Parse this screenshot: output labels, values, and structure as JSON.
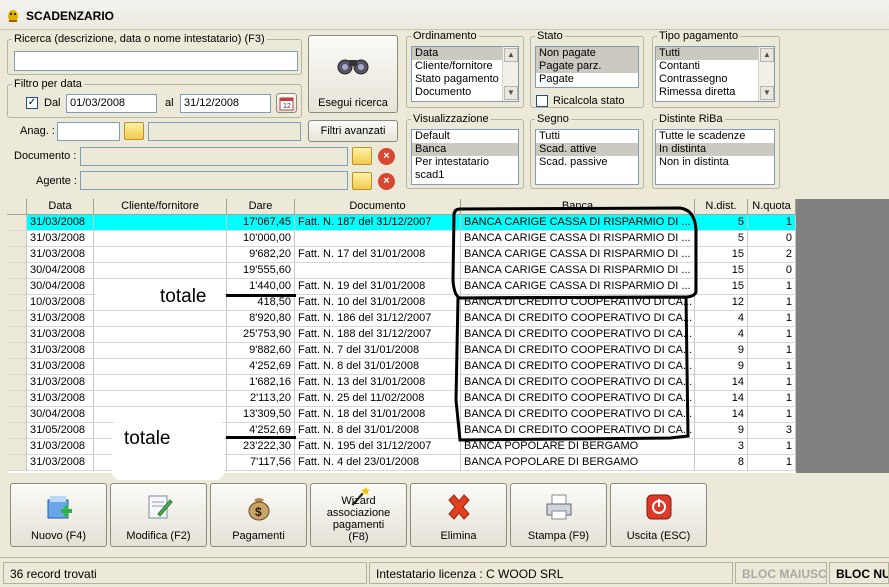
{
  "window": {
    "title": "SCADENZARIO"
  },
  "search": {
    "legend": "Ricerca (descrizione, data o nome intestatario) (F3)",
    "value": "",
    "button_label": "Esegui ricerca",
    "advanced_label": "Filtri avanzati"
  },
  "date_filter": {
    "legend": "Filtro per data",
    "from_label": "Dal",
    "from": "01/03/2008",
    "to_label": "al",
    "to": "31/12/2008",
    "checked": true
  },
  "fields": {
    "anag_label": "Anag. :",
    "documento_label": "Documento :",
    "agente_label": "Agente :"
  },
  "ordinamento": {
    "legend": "Ordinamento",
    "items": [
      "Data",
      "Cliente/fornitore",
      "Stato pagamento",
      "Documento"
    ],
    "selected": 0
  },
  "stato": {
    "legend": "Stato",
    "items": [
      "Non pagate",
      "Pagate parz.",
      "Pagate"
    ],
    "selected": [
      0,
      1
    ],
    "recalc_label": "Ricalcola stato"
  },
  "tipo_pagamento": {
    "legend": "Tipo pagamento",
    "items": [
      "Tutti",
      "Contanti",
      "Contrassegno",
      "Rimessa diretta"
    ],
    "selected": 0
  },
  "visualizzazione": {
    "legend": "Visualizzazione",
    "items": [
      "Default",
      "Banca",
      "Per intestatario",
      "scad1"
    ],
    "selected": 1
  },
  "segno": {
    "legend": "Segno",
    "items": [
      "Tutti",
      "Scad. attive",
      "Scad. passive"
    ],
    "selected": 1
  },
  "distinte": {
    "legend": "Distinte RiBa",
    "items": [
      "Tutte le scadenze",
      "In distinta",
      "Non in distinta"
    ],
    "selected": 1
  },
  "grid": {
    "columns": [
      "Data",
      "Cliente/fornitore",
      "Dare",
      "Documento",
      "Banca",
      "N.dist.",
      "N.quota"
    ],
    "rows": [
      [
        "31/03/2008",
        "",
        "17'067,45",
        "Fatt. N. 187 del 31/12/2007",
        "BANCA CARIGE CASSA DI RISPARMIO DI ...",
        "5",
        "1"
      ],
      [
        "31/03/2008",
        "",
        "10'000,00",
        "",
        "BANCA CARIGE CASSA DI RISPARMIO DI ...",
        "5",
        "0"
      ],
      [
        "31/03/2008",
        "",
        "9'682,20",
        "Fatt. N. 17 del 31/01/2008",
        "BANCA CARIGE CASSA DI RISPARMIO DI ...",
        "15",
        "2"
      ],
      [
        "30/04/2008",
        "",
        "19'555,60",
        "",
        "BANCA CARIGE CASSA DI RISPARMIO DI ...",
        "15",
        "0"
      ],
      [
        "30/04/2008",
        "",
        "1'440,00",
        "Fatt. N. 19 del 31/01/2008",
        "BANCA CARIGE CASSA DI RISPARMIO DI ...",
        "15",
        "1"
      ],
      [
        "10/03/2008",
        "",
        "418,50",
        "Fatt. N. 10 del 31/01/2008",
        "BANCA DI CREDITO COOPERATIVO DI CA...",
        "12",
        "1"
      ],
      [
        "31/03/2008",
        "",
        "8'920,80",
        "Fatt. N. 186 del 31/12/2007",
        "BANCA DI CREDITO COOPERATIVO DI CA...",
        "4",
        "1"
      ],
      [
        "31/03/2008",
        "",
        "25'753,90",
        "Fatt. N. 188 del 31/12/2007",
        "BANCA DI CREDITO COOPERATIVO DI CA...",
        "4",
        "1"
      ],
      [
        "31/03/2008",
        "",
        "9'882,60",
        "Fatt. N. 7 del 31/01/2008",
        "BANCA DI CREDITO COOPERATIVO DI CA...",
        "9",
        "1"
      ],
      [
        "31/03/2008",
        "",
        "4'252,69",
        "Fatt. N. 8 del 31/01/2008",
        "BANCA DI CREDITO COOPERATIVO DI CA...",
        "9",
        "1"
      ],
      [
        "31/03/2008",
        "",
        "1'682,16",
        "Fatt. N. 13 del 31/01/2008",
        "BANCA DI CREDITO COOPERATIVO DI CA...",
        "14",
        "1"
      ],
      [
        "31/03/2008",
        "",
        "2'113,20",
        "Fatt. N. 25 del 11/02/2008",
        "BANCA DI CREDITO COOPERATIVO DI CA...",
        "14",
        "1"
      ],
      [
        "30/04/2008",
        "",
        "13'309,50",
        "Fatt. N. 18 del 31/01/2008",
        "BANCA DI CREDITO COOPERATIVO DI CA...",
        "14",
        "1"
      ],
      [
        "31/05/2008",
        "",
        "4'252,69",
        "Fatt. N. 8 del 31/01/2008",
        "BANCA DI CREDITO COOPERATIVO DI CA...",
        "9",
        "3"
      ],
      [
        "31/03/2008",
        "",
        "23'222,30",
        "Fatt. N. 195 del 31/12/2007",
        "BANCA POPOLARE DI BERGAMO",
        "3",
        "1"
      ],
      [
        "31/03/2008",
        "",
        "7'117,56",
        "Fatt. N. 4 del 23/01/2008",
        "BANCA POPOLARE DI BERGAMO",
        "8",
        "1"
      ]
    ],
    "highlighted_row": 0
  },
  "annotations": [
    "totale",
    "totale"
  ],
  "toolbar": [
    {
      "label": "Nuovo (F4)",
      "icon": "new-icon"
    },
    {
      "label": "Modifica (F2)",
      "icon": "edit-icon"
    },
    {
      "label": "Pagamenti",
      "icon": "money-bag-icon"
    },
    {
      "label": "Wizard associazione pagamenti (F8)",
      "icon": "wizard-icon"
    },
    {
      "label": "Elimina",
      "icon": "delete-icon"
    },
    {
      "label": "Stampa (F9)",
      "icon": "printer-icon"
    },
    {
      "label": "Uscita (ESC)",
      "icon": "exit-icon"
    }
  ],
  "status": {
    "records": "36 record trovati",
    "license": "Intestatario licenza : C WOOD SRL",
    "caps": "BLOC MAIUSC",
    "num": "BLOC NUM"
  }
}
